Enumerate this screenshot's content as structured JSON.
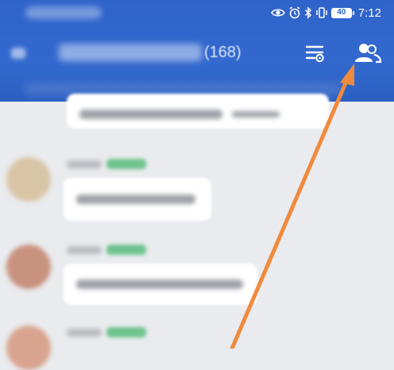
{
  "status_bar": {
    "battery_level": "40",
    "time": "7:12",
    "icons": [
      "eye-icon",
      "alarm-icon",
      "bluetooth-icon",
      "vibrate-icon",
      "battery-icon"
    ]
  },
  "nav": {
    "member_count": "(168)",
    "menu_icon": "settings-list-icon",
    "members_icon": "group-members-icon"
  },
  "colors": {
    "header": "#3369cf",
    "background": "#e9ebee",
    "bubble": "#ffffff",
    "tag": "#6fc38f",
    "annotation_arrow": "#f08a3c"
  }
}
